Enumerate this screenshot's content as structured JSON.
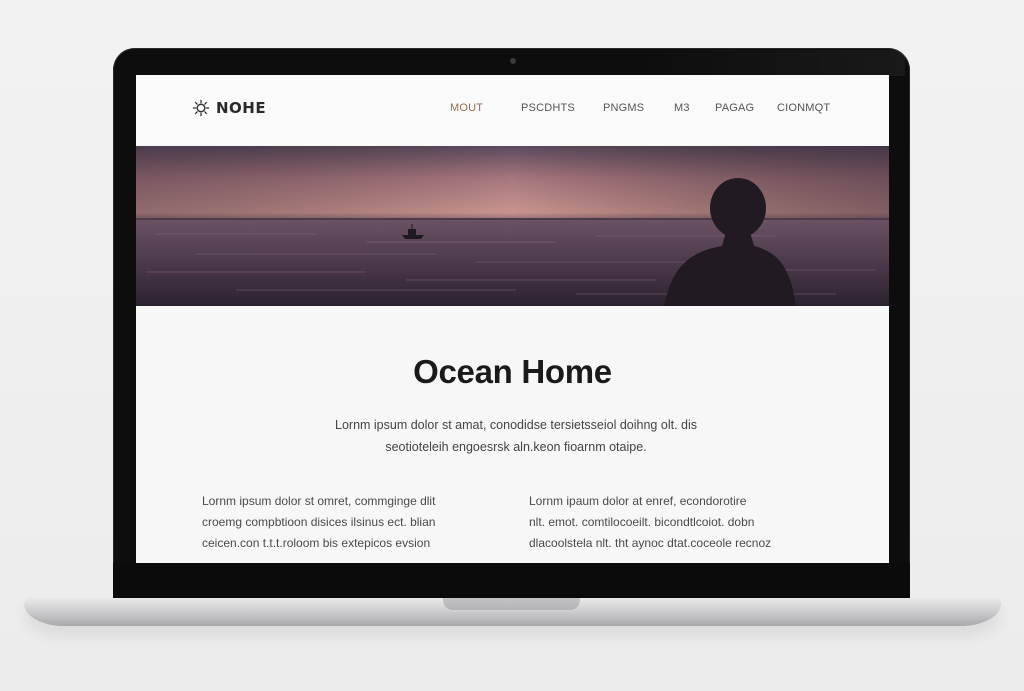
{
  "site": {
    "logo_text": "NOHE",
    "nav": [
      {
        "label": "MOUT",
        "active": true
      },
      {
        "label": "PSCDHTS",
        "active": false
      },
      {
        "label": "PNGMS",
        "active": false
      },
      {
        "label": "M3",
        "active": false
      },
      {
        "label": "PAGAG",
        "active": false
      },
      {
        "label": "CIONMQT",
        "active": false
      }
    ]
  },
  "hero": {
    "icon": "sunset-ocean-silhouette-image"
  },
  "content": {
    "title": "Ocean Home",
    "intro_line1": "Lornm ipsum dolor st amat, conodidse tersietsseiol doihng olt. dis",
    "intro_line2": "seotioteleih engoesrsk aln.keon fioarnm otaipe.",
    "col_left": [
      "Lornm ipsum dolor st omret, commginge dlit",
      "croemg compbtioon disices ilsinus ect. blian",
      "ceicen.con t.t.t.roloom bis extepicos evsion"
    ],
    "col_right": [
      "Lornm ipaum dolor at enref, econdorotire",
      "nlt. emot. comtilocoeilt. bicondtlcoiot. dobn",
      "dlacoolstela nlt. tht aynoc dtat.coceole recnoz"
    ]
  },
  "colors": {
    "accent_nav": "#9a6b4f",
    "sky_top": "#6b5566",
    "sky_horizon": "#c48f90",
    "sea": "#3a2c3a"
  }
}
